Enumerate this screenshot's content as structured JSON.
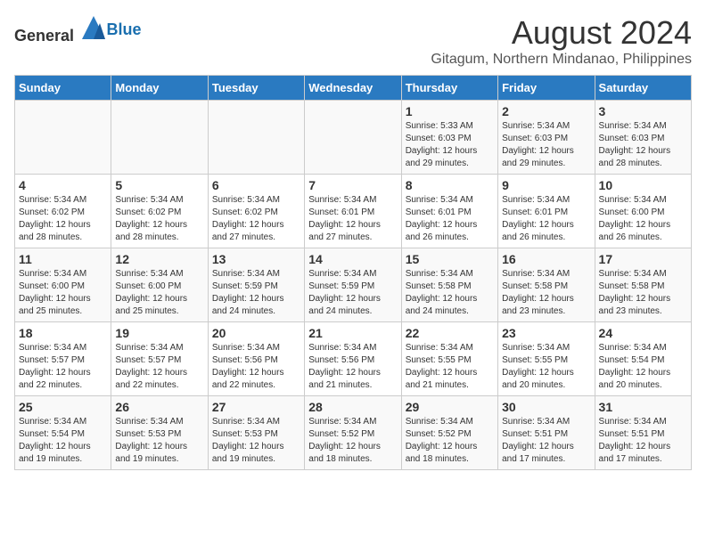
{
  "logo": {
    "text_general": "General",
    "text_blue": "Blue"
  },
  "title": "August 2024",
  "subtitle": "Gitagum, Northern Mindanao, Philippines",
  "days_of_week": [
    "Sunday",
    "Monday",
    "Tuesday",
    "Wednesday",
    "Thursday",
    "Friday",
    "Saturday"
  ],
  "weeks": [
    [
      {
        "day": "",
        "info": ""
      },
      {
        "day": "",
        "info": ""
      },
      {
        "day": "",
        "info": ""
      },
      {
        "day": "",
        "info": ""
      },
      {
        "day": "1",
        "info": "Sunrise: 5:33 AM\nSunset: 6:03 PM\nDaylight: 12 hours\nand 29 minutes."
      },
      {
        "day": "2",
        "info": "Sunrise: 5:34 AM\nSunset: 6:03 PM\nDaylight: 12 hours\nand 29 minutes."
      },
      {
        "day": "3",
        "info": "Sunrise: 5:34 AM\nSunset: 6:03 PM\nDaylight: 12 hours\nand 28 minutes."
      }
    ],
    [
      {
        "day": "4",
        "info": "Sunrise: 5:34 AM\nSunset: 6:02 PM\nDaylight: 12 hours\nand 28 minutes."
      },
      {
        "day": "5",
        "info": "Sunrise: 5:34 AM\nSunset: 6:02 PM\nDaylight: 12 hours\nand 28 minutes."
      },
      {
        "day": "6",
        "info": "Sunrise: 5:34 AM\nSunset: 6:02 PM\nDaylight: 12 hours\nand 27 minutes."
      },
      {
        "day": "7",
        "info": "Sunrise: 5:34 AM\nSunset: 6:01 PM\nDaylight: 12 hours\nand 27 minutes."
      },
      {
        "day": "8",
        "info": "Sunrise: 5:34 AM\nSunset: 6:01 PM\nDaylight: 12 hours\nand 26 minutes."
      },
      {
        "day": "9",
        "info": "Sunrise: 5:34 AM\nSunset: 6:01 PM\nDaylight: 12 hours\nand 26 minutes."
      },
      {
        "day": "10",
        "info": "Sunrise: 5:34 AM\nSunset: 6:00 PM\nDaylight: 12 hours\nand 26 minutes."
      }
    ],
    [
      {
        "day": "11",
        "info": "Sunrise: 5:34 AM\nSunset: 6:00 PM\nDaylight: 12 hours\nand 25 minutes."
      },
      {
        "day": "12",
        "info": "Sunrise: 5:34 AM\nSunset: 6:00 PM\nDaylight: 12 hours\nand 25 minutes."
      },
      {
        "day": "13",
        "info": "Sunrise: 5:34 AM\nSunset: 5:59 PM\nDaylight: 12 hours\nand 24 minutes."
      },
      {
        "day": "14",
        "info": "Sunrise: 5:34 AM\nSunset: 5:59 PM\nDaylight: 12 hours\nand 24 minutes."
      },
      {
        "day": "15",
        "info": "Sunrise: 5:34 AM\nSunset: 5:58 PM\nDaylight: 12 hours\nand 24 minutes."
      },
      {
        "day": "16",
        "info": "Sunrise: 5:34 AM\nSunset: 5:58 PM\nDaylight: 12 hours\nand 23 minutes."
      },
      {
        "day": "17",
        "info": "Sunrise: 5:34 AM\nSunset: 5:58 PM\nDaylight: 12 hours\nand 23 minutes."
      }
    ],
    [
      {
        "day": "18",
        "info": "Sunrise: 5:34 AM\nSunset: 5:57 PM\nDaylight: 12 hours\nand 22 minutes."
      },
      {
        "day": "19",
        "info": "Sunrise: 5:34 AM\nSunset: 5:57 PM\nDaylight: 12 hours\nand 22 minutes."
      },
      {
        "day": "20",
        "info": "Sunrise: 5:34 AM\nSunset: 5:56 PM\nDaylight: 12 hours\nand 22 minutes."
      },
      {
        "day": "21",
        "info": "Sunrise: 5:34 AM\nSunset: 5:56 PM\nDaylight: 12 hours\nand 21 minutes."
      },
      {
        "day": "22",
        "info": "Sunrise: 5:34 AM\nSunset: 5:55 PM\nDaylight: 12 hours\nand 21 minutes."
      },
      {
        "day": "23",
        "info": "Sunrise: 5:34 AM\nSunset: 5:55 PM\nDaylight: 12 hours\nand 20 minutes."
      },
      {
        "day": "24",
        "info": "Sunrise: 5:34 AM\nSunset: 5:54 PM\nDaylight: 12 hours\nand 20 minutes."
      }
    ],
    [
      {
        "day": "25",
        "info": "Sunrise: 5:34 AM\nSunset: 5:54 PM\nDaylight: 12 hours\nand 19 minutes."
      },
      {
        "day": "26",
        "info": "Sunrise: 5:34 AM\nSunset: 5:53 PM\nDaylight: 12 hours\nand 19 minutes."
      },
      {
        "day": "27",
        "info": "Sunrise: 5:34 AM\nSunset: 5:53 PM\nDaylight: 12 hours\nand 19 minutes."
      },
      {
        "day": "28",
        "info": "Sunrise: 5:34 AM\nSunset: 5:52 PM\nDaylight: 12 hours\nand 18 minutes."
      },
      {
        "day": "29",
        "info": "Sunrise: 5:34 AM\nSunset: 5:52 PM\nDaylight: 12 hours\nand 18 minutes."
      },
      {
        "day": "30",
        "info": "Sunrise: 5:34 AM\nSunset: 5:51 PM\nDaylight: 12 hours\nand 17 minutes."
      },
      {
        "day": "31",
        "info": "Sunrise: 5:34 AM\nSunset: 5:51 PM\nDaylight: 12 hours\nand 17 minutes."
      }
    ]
  ]
}
